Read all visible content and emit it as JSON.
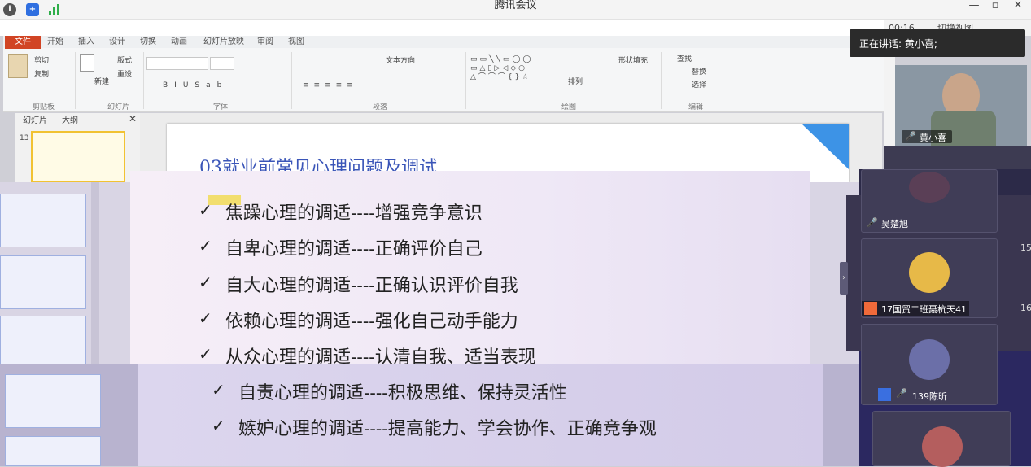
{
  "window": {
    "title": "腾讯会议",
    "timer": "00:16",
    "view_label": "切换视图"
  },
  "ribbon": {
    "file_tab": "文件",
    "tabs": [
      "开始",
      "插入",
      "设计",
      "切换",
      "动画",
      "幻灯片放映",
      "审阅",
      "视图"
    ],
    "clipboard": {
      "cut": "剪切",
      "copy": "复制",
      "group": "剪贴板"
    },
    "slides": {
      "layout": "版式",
      "reset": "重设",
      "new": "新建",
      "group": "幻灯片"
    },
    "font_group": "字体",
    "paragraph_group": "段落",
    "drawing_group": "绘图",
    "editing_group": "编辑",
    "text_direction": "文本方向",
    "shape_fill": "形状填充",
    "find": "查找",
    "replace": "替换",
    "select": "选择",
    "arrange": "排列"
  },
  "pane": {
    "tab_slides": "幻灯片",
    "tab_outline": "大纲",
    "slide_number": "13"
  },
  "slide": {
    "title": "03就业前常见心理问题及调试",
    "bullets": [
      "焦躁心理的调适----增强竞争意识",
      "自卑心理的调适----正确评价自己",
      "自大心理的调适----正确认识评价自我",
      "依赖心理的调适----强化自己动手能力",
      "从众心理的调适----认清自我、适当表现",
      "自责心理的调适----积极思维、保持灵活性",
      "嫉妒心理的调适----提高能力、学会协作、正确竞争观"
    ],
    "check": "✓"
  },
  "meeting": {
    "speaking_label": "正在讲话: 黄小喜;",
    "speaker_name": "黄小喜",
    "participants": [
      "吴楚旭",
      "17国贸二班聂杭天41",
      "139陈昕"
    ],
    "side_numbers": [
      "15",
      "16"
    ]
  },
  "colors": {
    "accent": "#2f8fe8",
    "file_tab": "#d14424"
  }
}
